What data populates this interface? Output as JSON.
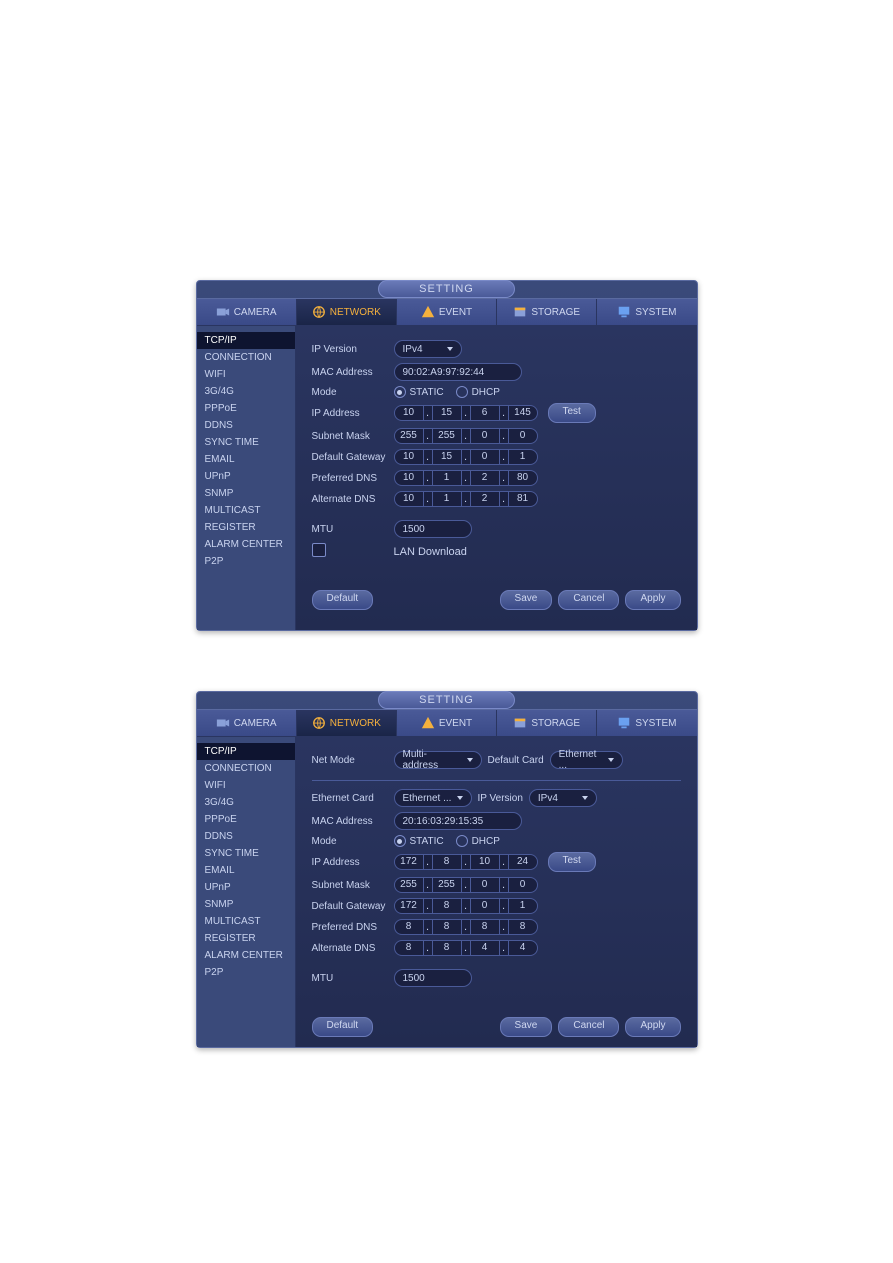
{
  "shared": {
    "title": "SETTING",
    "tabs": {
      "camera": "CAMERA",
      "network": "NETWORK",
      "event": "EVENT",
      "storage": "STORAGE",
      "system": "SYSTEM"
    },
    "sidebar": [
      "TCP/IP",
      "CONNECTION",
      "WIFI",
      "3G/4G",
      "PPPoE",
      "DDNS",
      "SYNC TIME",
      "EMAIL",
      "UPnP",
      "SNMP",
      "MULTICAST",
      "REGISTER",
      "ALARM CENTER",
      "P2P"
    ],
    "labels": {
      "ip_version": "IP Version",
      "mac": "MAC Address",
      "mode": "Mode",
      "ip_addr": "IP Address",
      "subnet": "Subnet Mask",
      "gateway": "Default Gateway",
      "pref_dns": "Preferred DNS",
      "alt_dns": "Alternate DNS",
      "mtu": "MTU",
      "lan_dl": "LAN Download",
      "net_mode": "Net Mode",
      "default_card": "Default Card",
      "eth_card": "Ethernet Card"
    },
    "mode_opts": {
      "static": "STATIC",
      "dhcp": "DHCP"
    },
    "buttons": {
      "default": "Default",
      "save": "Save",
      "cancel": "Cancel",
      "apply": "Apply",
      "test": "Test"
    },
    "ipv4": "IPv4"
  },
  "win1": {
    "mac": "90:02:A9:97:92:44",
    "ip": [
      "10",
      "15",
      "6",
      "145"
    ],
    "subnet": [
      "255",
      "255",
      "0",
      "0"
    ],
    "gateway": [
      "10",
      "15",
      "0",
      "1"
    ],
    "pref_dns": [
      "10",
      "1",
      "2",
      "80"
    ],
    "alt_dns": [
      "10",
      "1",
      "2",
      "81"
    ],
    "mtu": "1500"
  },
  "win2": {
    "net_mode": "Multi-address",
    "default_card": "Ethernet ...",
    "eth_card": "Ethernet ...",
    "mac": "20:16:03:29:15:35",
    "ip": [
      "172",
      "8",
      "10",
      "24"
    ],
    "subnet": [
      "255",
      "255",
      "0",
      "0"
    ],
    "gateway": [
      "172",
      "8",
      "0",
      "1"
    ],
    "pref_dns": [
      "8",
      "8",
      "8",
      "8"
    ],
    "alt_dns": [
      "8",
      "8",
      "4",
      "4"
    ],
    "mtu": "1500"
  }
}
